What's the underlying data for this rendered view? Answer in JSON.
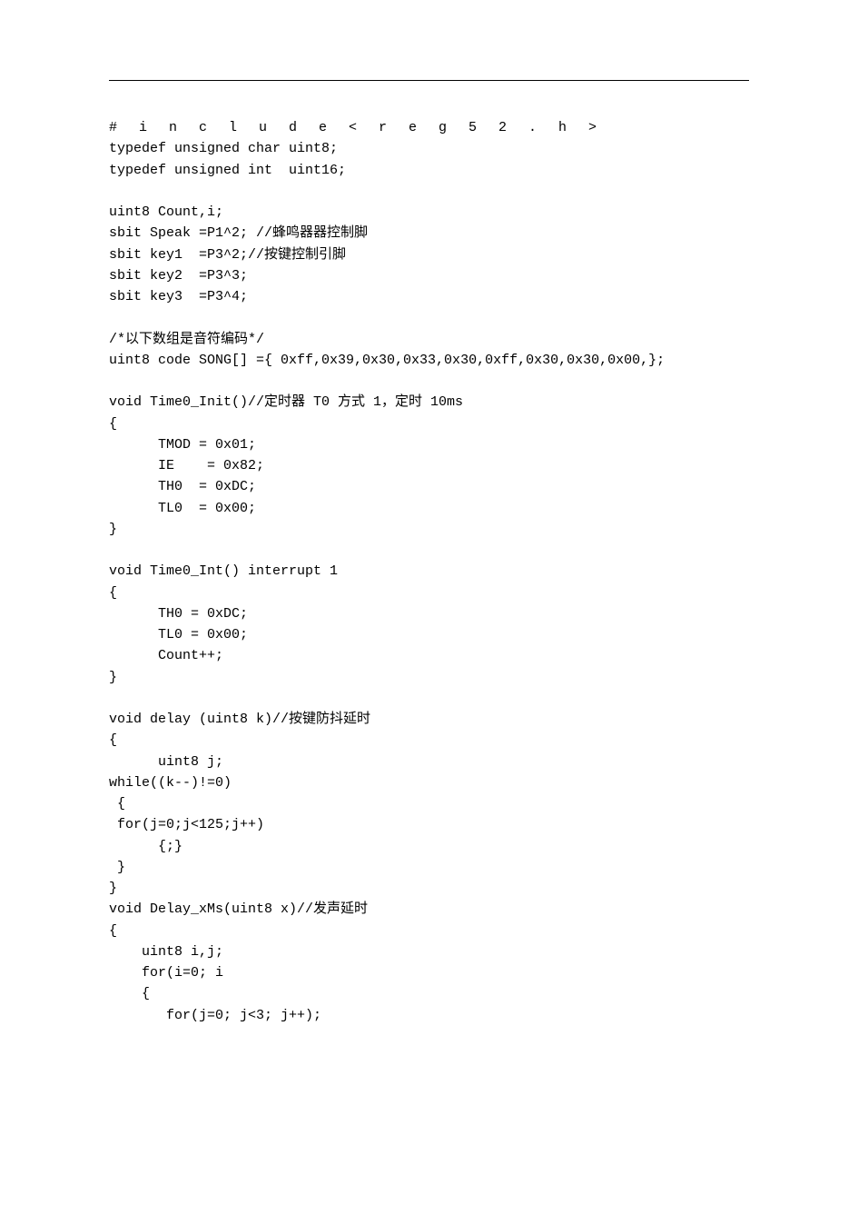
{
  "include_line": "#include<reg52.h>",
  "code": "typedef unsigned char uint8;\ntypedef unsigned int  uint16;\n\nuint8 Count,i;\nsbit Speak =P1^2; //蜂鸣器器控制脚\nsbit key1  =P3^2;//按键控制引脚\nsbit key2  =P3^3;\nsbit key3  =P3^4;\n\n/*以下数组是音符编码*/\nuint8 code SONG[] ={ 0xff,0x39,0x30,0x33,0x30,0xff,0x30,0x30,0x00,};\n\nvoid Time0_Init()//定时器 T0 方式 1，定时 10ms\n{\n      TMOD = 0x01;\n      IE    = 0x82;\n      TH0  = 0xDC;\n      TL0  = 0x00;\n}\n\nvoid Time0_Int() interrupt 1\n{\n      TH0 = 0xDC;\n      TL0 = 0x00;\n      Count++;\n}\n\nvoid delay (uint8 k)//按键防抖延时\n{\n      uint8 j;\nwhile((k--)!=0)\n {\n for(j=0;j<125;j++)\n      {;}\n }\n}\nvoid Delay_xMs(uint8 x)//发声延时\n{\n    uint8 i,j;\n    for(i=0; i\n    {\n       for(j=0; j<3; j++);"
}
